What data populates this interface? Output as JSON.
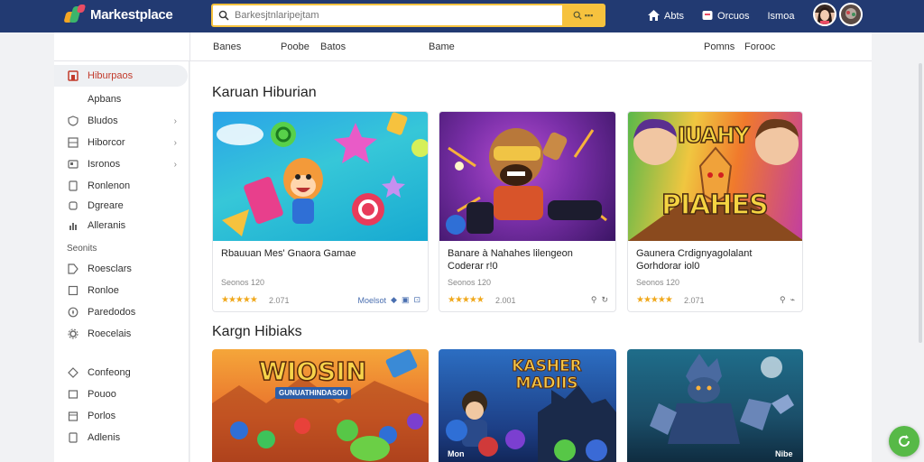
{
  "header": {
    "brand": "Markestplace",
    "search_placeholder": "Barkesjtnlaripejtam",
    "search_button": "▪▪▪",
    "links": [
      {
        "label": "Abts",
        "icon": "home-icon"
      },
      {
        "label": "Orcuos",
        "icon": "cart-icon"
      },
      {
        "label": "Ismoa",
        "icon": "menu-icon"
      }
    ]
  },
  "subnav": {
    "items": [
      "Banes",
      "Poobe",
      "Batos",
      "Bame",
      "Pomns",
      "Forooc"
    ]
  },
  "sidebar": {
    "items": [
      {
        "label": "Hiburpaos",
        "icon": "home-icon",
        "active": true
      },
      {
        "label": "Apbans",
        "icon": "list-icon"
      },
      {
        "label": "Bludos",
        "icon": "shield-icon",
        "chevron": true
      },
      {
        "label": "Hiborcor",
        "icon": "grid-icon",
        "chevron": true
      },
      {
        "label": "Isronos",
        "icon": "window-icon",
        "chevron": true
      },
      {
        "label": "Ronlenon",
        "icon": "file-icon"
      },
      {
        "label": "Dgreare",
        "icon": "box-icon"
      },
      {
        "label": "Alleranis",
        "icon": "chart-icon"
      }
    ],
    "section_heading": "Seonits",
    "section_items": [
      {
        "label": "Roesclars",
        "icon": "tag-icon"
      },
      {
        "label": "Ronloe",
        "icon": "square-icon"
      },
      {
        "label": "Paredodos",
        "icon": "compass-icon"
      },
      {
        "label": "Roecelais",
        "icon": "gear-icon"
      }
    ],
    "bottom_items": [
      {
        "label": "Confeong",
        "icon": "diamond-icon"
      },
      {
        "label": "Pouoo",
        "icon": "square-icon"
      },
      {
        "label": "Porlos",
        "icon": "calendar-icon"
      },
      {
        "label": "Adlenis",
        "icon": "file-icon"
      }
    ]
  },
  "main": {
    "section1_title": "Karuan Hiburian",
    "section2_title": "Kargn Hibiaks",
    "cards": [
      {
        "name": "Rbauuan Mes' Gnaora Gamae",
        "meta": "Seonos 120",
        "stars": "★★★★★",
        "rating": "2.071",
        "acts": [
          "Moelsot",
          "◆",
          "▣",
          "⊡"
        ]
      },
      {
        "name": "Banare à Nahahes lilengeon Coderar r!0",
        "meta": "Seonos 120",
        "stars": "★★★★★",
        "rating": "2.001",
        "acts": [
          "⚲",
          "↻"
        ]
      },
      {
        "name": "Gaunera Crdignyagolalant Gorhdorar iol0",
        "meta": "Seonos 120",
        "stars": "★★★★★",
        "rating": "2.071",
        "acts": [
          "⚲",
          "⌁"
        ]
      }
    ],
    "row2_titles": [
      "WIOSIN",
      "KASHER MADIIS",
      ""
    ],
    "row2_subtitles": [
      "GUNUATHINDASOU",
      "",
      ""
    ],
    "card3_title_a": "IUAHY",
    "card3_title_b": "PIAHES",
    "card4_footer": "Mon",
    "card6_footer": "Nibe"
  }
}
